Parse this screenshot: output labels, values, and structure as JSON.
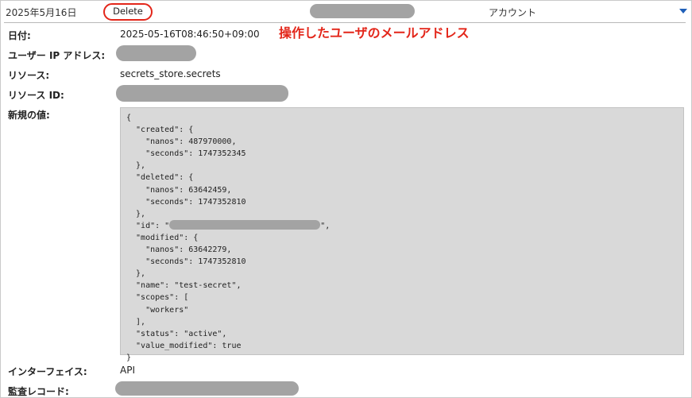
{
  "header": {
    "date": "2025年5月16日",
    "action": "Delete",
    "account_label": "アカウント"
  },
  "annotation": "操作したユーザのメールアドレス",
  "fields": {
    "datetime_label": "日付:",
    "datetime_value": "2025-05-16T08:46:50+09:00",
    "user_ip_label": "ユーザー IP アドレス:",
    "resource_label": "リソース:",
    "resource_value": "secrets_store.secrets",
    "resource_id_label": "リソース ID:",
    "new_value_label": "新規の値:",
    "interface_label": "インターフェイス:",
    "interface_value": "API",
    "audit_record_label": "監査レコード:"
  },
  "json_lines": {
    "l01": "{",
    "l02": "  \"created\": {",
    "l03": "    \"nanos\": 487970000,",
    "l04": "    \"seconds\": 1747352345",
    "l05": "  },",
    "l06": "  \"deleted\": {",
    "l07": "    \"nanos\": 63642459,",
    "l08": "    \"seconds\": 1747352810",
    "l09": "  },",
    "l10a": "  \"id\": \"",
    "l10b": "\",",
    "l11": "  \"modified\": {",
    "l12": "    \"nanos\": 63642279,",
    "l13": "    \"seconds\": 1747352810",
    "l14": "  },",
    "l15": "  \"name\": \"test-secret\",",
    "l16": "  \"scopes\": [",
    "l17": "    \"workers\"",
    "l18": "  ],",
    "l19": "  \"status\": \"active\",",
    "l20": "  \"value_modified\": true",
    "l21": "}"
  },
  "colors": {
    "annotation_red": "#e3261a",
    "redaction_gray": "#a3a3a3",
    "json_bg": "#d9d9d9",
    "caret_blue": "#1f5fb8"
  }
}
